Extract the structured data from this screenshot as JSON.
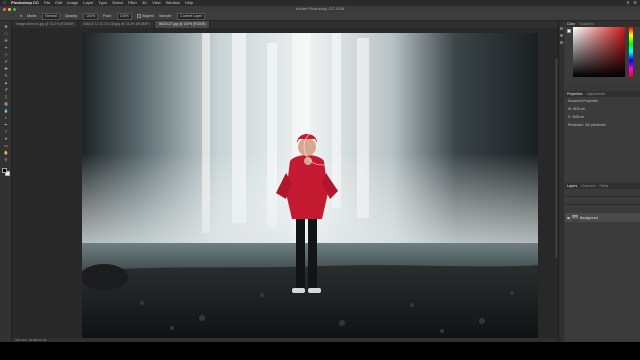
{
  "menubar": {
    "app": "Photoshop CC",
    "items": [
      "File",
      "Edit",
      "Image",
      "Layer",
      "Type",
      "Select",
      "Filter",
      "3D",
      "View",
      "Window",
      "Help"
    ]
  },
  "window": {
    "title": "Adobe Photoshop CC 2018"
  },
  "options": {
    "mode_label": "Mode:",
    "mode_value": "Normal",
    "opacity_label": "Opacity:",
    "opacity_value": "100%",
    "flow_label": "Flow:",
    "flow_value": "100%",
    "aligned": "Aligned",
    "sample_label": "Sample:",
    "sample_value": "Current Layer"
  },
  "tabs": [
    {
      "label": "Image Airbrush.jpg @ 33.3% (RGB/8*)"
    },
    {
      "label": "IMAGE 12.10.22.138.jpg @ 33.3% (RGB/8*)"
    },
    {
      "label": "IMG0127.jpg @ 100% (RGB/8)"
    }
  ],
  "status": {
    "text": "33% Doc: 18.9M/37.7M"
  },
  "panels": {
    "color_tabs": [
      "Color",
      "Swatches"
    ],
    "properties_tabs": [
      "Properties",
      "Adjustments"
    ],
    "properties_title": "Document Properties",
    "properties_w": "W: 3628 cm",
    "properties_h": "H: 3628 cm",
    "resolution": "Resolution: 240 pixels/inch",
    "layers_tabs": [
      "Layers",
      "Channels",
      "Paths"
    ],
    "layer_name": "Background"
  },
  "colors": {
    "accent_red": "#c41b32",
    "panel_bg": "#383838"
  }
}
